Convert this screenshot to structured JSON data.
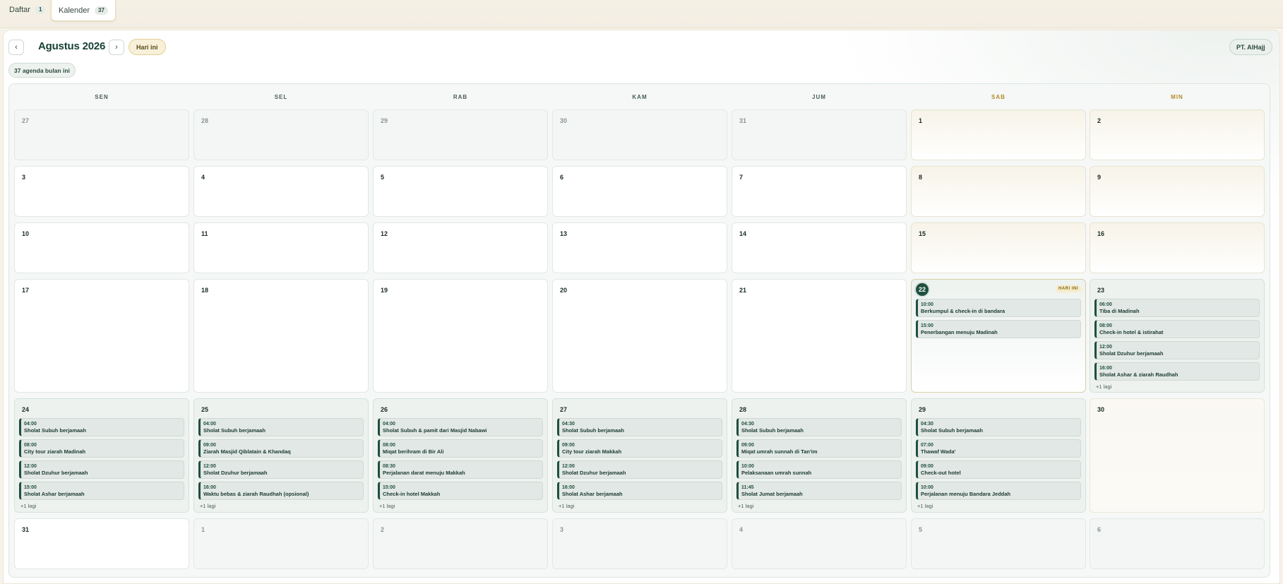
{
  "tabs": [
    {
      "label": "Daftar",
      "count": "1"
    },
    {
      "label": "Kalender",
      "count": "37"
    }
  ],
  "toolbar": {
    "prev": "‹",
    "next": "›",
    "month_title": "Agustus 2026",
    "today_button": "Hari ini",
    "org": "PT. AlHajj",
    "count_chip": "37 agenda bulan ini"
  },
  "weekdays": [
    "SEN",
    "SEL",
    "RAB",
    "KAM",
    "JUM",
    "SAB",
    "MIN"
  ],
  "today_label": "HARI INI",
  "more_label": "+1 lagi",
  "weeks": [
    [
      {
        "day": "27",
        "type": "other"
      },
      {
        "day": "28",
        "type": "other"
      },
      {
        "day": "29",
        "type": "other"
      },
      {
        "day": "30",
        "type": "other"
      },
      {
        "day": "31",
        "type": "other"
      },
      {
        "day": "1",
        "type": "weekend"
      },
      {
        "day": "2",
        "type": "weekend"
      }
    ],
    [
      {
        "day": "3"
      },
      {
        "day": "4"
      },
      {
        "day": "5"
      },
      {
        "day": "6"
      },
      {
        "day": "7"
      },
      {
        "day": "8",
        "type": "weekend"
      },
      {
        "day": "9",
        "type": "weekend"
      }
    ],
    [
      {
        "day": "10"
      },
      {
        "day": "11"
      },
      {
        "day": "12"
      },
      {
        "day": "13"
      },
      {
        "day": "14"
      },
      {
        "day": "15",
        "type": "weekend"
      },
      {
        "day": "16",
        "type": "weekend"
      }
    ],
    [
      {
        "day": "17"
      },
      {
        "day": "18"
      },
      {
        "day": "19"
      },
      {
        "day": "20"
      },
      {
        "day": "21"
      },
      {
        "day": "22",
        "type": "today",
        "events": [
          {
            "time": "10:00",
            "title": "Berkumpul & check-in di bandara"
          },
          {
            "time": "15:00",
            "title": "Penerbangan menuju Madinah"
          }
        ]
      },
      {
        "day": "23",
        "type": "busy",
        "more": true,
        "events": [
          {
            "time": "06:00",
            "title": "Tiba di Madinah"
          },
          {
            "time": "08:00",
            "title": "Check-in hotel & istirahat"
          },
          {
            "time": "12:00",
            "title": "Sholat Dzuhur berjamaah"
          },
          {
            "time": "16:00",
            "title": "Sholat Ashar & ziarah Raudhah"
          }
        ]
      }
    ],
    [
      {
        "day": "24",
        "type": "busy",
        "more": true,
        "events": [
          {
            "time": "04:00",
            "title": "Sholat Subuh berjamaah"
          },
          {
            "time": "08:00",
            "title": "City tour ziarah Madinah"
          },
          {
            "time": "12:00",
            "title": "Sholat Dzuhur berjamaah"
          },
          {
            "time": "15:00",
            "title": "Sholat Ashar berjamaah"
          }
        ]
      },
      {
        "day": "25",
        "type": "busy",
        "more": true,
        "events": [
          {
            "time": "04:00",
            "title": "Sholat Subuh berjamaah"
          },
          {
            "time": "09:00",
            "title": "Ziarah Masjid Qiblatain & Khandaq"
          },
          {
            "time": "12:00",
            "title": "Sholat Dzuhur berjamaah"
          },
          {
            "time": "16:00",
            "title": "Waktu bebas & ziarah Raudhah (opsional)"
          }
        ]
      },
      {
        "day": "26",
        "type": "busy",
        "more": true,
        "events": [
          {
            "time": "04:00",
            "title": "Sholat Subuh & pamit dari Masjid Nabawi"
          },
          {
            "time": "08:00",
            "title": "Miqat berihram di Bir Ali"
          },
          {
            "time": "08:30",
            "title": "Perjalanan darat menuju Makkah"
          },
          {
            "time": "15:00",
            "title": "Check-in hotel Makkah"
          }
        ]
      },
      {
        "day": "27",
        "type": "busy",
        "more": true,
        "events": [
          {
            "time": "04:30",
            "title": "Sholat Subuh berjamaah"
          },
          {
            "time": "09:00",
            "title": "City tour ziarah Makkah"
          },
          {
            "time": "12:00",
            "title": "Sholat Dzuhur berjamaah"
          },
          {
            "time": "16:00",
            "title": "Sholat Ashar berjamaah"
          }
        ]
      },
      {
        "day": "28",
        "type": "busy",
        "more": true,
        "events": [
          {
            "time": "04:30",
            "title": "Sholat Subuh berjamaah"
          },
          {
            "time": "09:00",
            "title": "Miqat umrah sunnah di Tan'im"
          },
          {
            "time": "10:00",
            "title": "Pelaksanaan umrah sunnah"
          },
          {
            "time": "11:45",
            "title": "Sholat Jumat berjamaah"
          }
        ]
      },
      {
        "day": "29",
        "type": "busy",
        "more": true,
        "events": [
          {
            "time": "04:30",
            "title": "Sholat Subuh berjamaah"
          },
          {
            "time": "07:00",
            "title": "Thawaf Wada'"
          },
          {
            "time": "09:00",
            "title": "Check-out hotel"
          },
          {
            "time": "10:00",
            "title": "Perjalanan menuju Bandara Jeddah"
          }
        ]
      },
      {
        "day": "30",
        "type": "weekend-empty"
      }
    ],
    [
      {
        "day": "31"
      },
      {
        "day": "1",
        "type": "other"
      },
      {
        "day": "2",
        "type": "other"
      },
      {
        "day": "3",
        "type": "other"
      },
      {
        "day": "4",
        "type": "other"
      },
      {
        "day": "5",
        "type": "other"
      },
      {
        "day": "6",
        "type": "other"
      }
    ]
  ]
}
